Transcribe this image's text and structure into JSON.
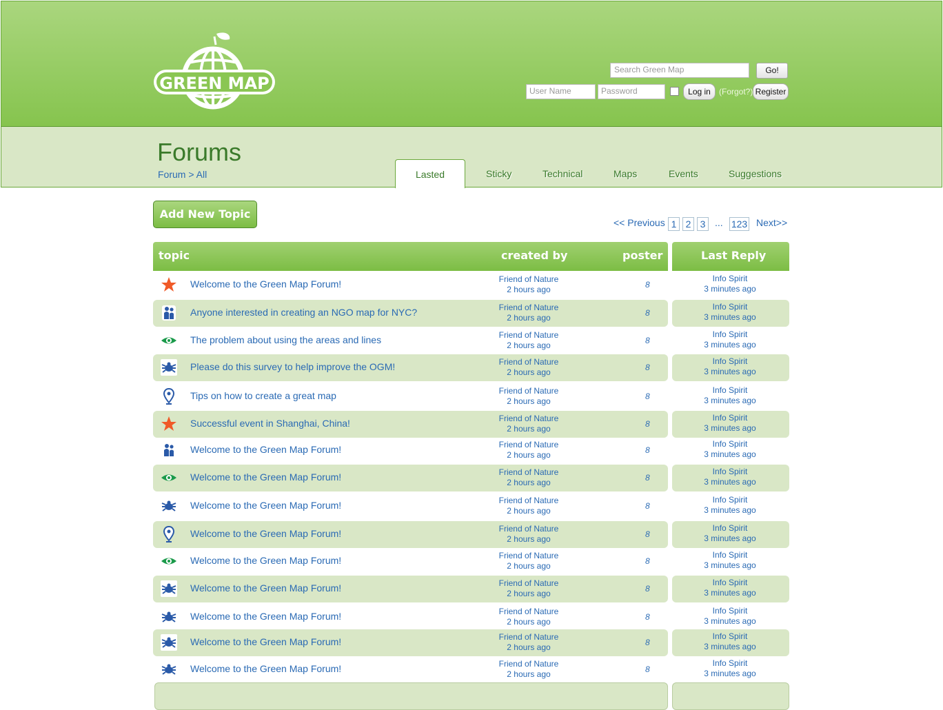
{
  "header": {
    "logo_text": "GREEN MAP",
    "search": {
      "placeholder": "Search Green Map",
      "button": "Go!"
    },
    "login": {
      "username_placeholder": "User Name",
      "password_placeholder": "Password",
      "login_button": "Log in",
      "forgot": "(Forgot?)",
      "register_button": "Register"
    }
  },
  "page": {
    "title": "Forums",
    "breadcrumb": "Forum > All"
  },
  "tabs": [
    {
      "label": "Lasted",
      "active": true
    },
    {
      "label": "Sticky"
    },
    {
      "label": "Technical"
    },
    {
      "label": "Maps"
    },
    {
      "label": "Events"
    },
    {
      "label": "Suggestions"
    }
  ],
  "actions": {
    "add_topic": "Add New Topic"
  },
  "pager": {
    "previous": "<< Previous",
    "pages": [
      "1",
      "2",
      "3"
    ],
    "ellipsis": "...",
    "last_page": "123",
    "next": "Next>>"
  },
  "table": {
    "headers": {
      "topic": "topic",
      "created_by": "created by",
      "poster": "poster",
      "last_reply": "Last Reply"
    },
    "rows": [
      {
        "icon": "star-icon",
        "title": "Welcome to the Green Map Forum!",
        "creator": "Friend of Nature",
        "created": "2 hours ago",
        "poster": "8",
        "last_user": "Info Spirit",
        "last_time": "3 minutes ago"
      },
      {
        "icon": "people-icon",
        "title": "Anyone interested in creating an NGO map for NYC?",
        "creator": "Friend of Nature",
        "created": "2 hours ago",
        "poster": "8",
        "last_user": "Info Spirit",
        "last_time": "3 minutes ago"
      },
      {
        "icon": "eye-icon",
        "title": "The problem about using the areas and lines",
        "creator": "Friend of Nature",
        "created": "2 hours ago",
        "poster": "8",
        "last_user": "Info Spirit",
        "last_time": "3 minutes ago"
      },
      {
        "icon": "bug-icon",
        "title": "Please do this survey to help improve the OGM!",
        "creator": "Friend of Nature",
        "created": "2 hours ago",
        "poster": "8",
        "last_user": "Info Spirit",
        "last_time": "3 minutes ago"
      },
      {
        "icon": "pin-icon",
        "title": "Tips on how to create a great map",
        "creator": "Friend of Nature",
        "created": "2 hours ago",
        "poster": "8",
        "last_user": "Info Spirit",
        "last_time": "3 minutes ago"
      },
      {
        "icon": "star-icon",
        "title": "Successful event in Shanghai, China!",
        "creator": "Friend of Nature",
        "created": "2 hours ago",
        "poster": "8",
        "last_user": "Info Spirit",
        "last_time": "3 minutes ago"
      },
      {
        "icon": "people-icon",
        "title": "Welcome to the Green Map Forum!",
        "creator": "Friend of Nature",
        "created": "2 hours ago",
        "poster": "8",
        "last_user": "Info Spirit",
        "last_time": "3 minutes ago"
      },
      {
        "icon": "eye-icon",
        "title": "Welcome to the Green Map Forum!",
        "creator": "Friend of Nature",
        "created": "2 hours ago",
        "poster": "8",
        "last_user": "Info Spirit",
        "last_time": "3 minutes ago"
      },
      {
        "icon": "bug-icon",
        "title": "Welcome to the Green Map Forum!",
        "creator": "Friend of Nature",
        "created": "2 hours ago",
        "poster": "8",
        "last_user": "Info Spirit",
        "last_time": "3 minutes ago"
      },
      {
        "icon": "pin-icon",
        "title": "Welcome to the Green Map Forum!",
        "creator": "Friend of Nature",
        "created": "2 hours ago",
        "poster": "8",
        "last_user": "Info Spirit",
        "last_time": "3 minutes ago"
      },
      {
        "icon": "eye-icon",
        "title": "Welcome to the Green Map Forum!",
        "creator": "Friend of Nature",
        "created": "2 hours ago",
        "poster": "8",
        "last_user": "Info Spirit",
        "last_time": "3 minutes ago"
      },
      {
        "icon": "bug-icon",
        "title": "Welcome to the Green Map Forum!",
        "creator": "Friend of Nature",
        "created": "2 hours ago",
        "poster": "8",
        "last_user": "Info Spirit",
        "last_time": "3 minutes ago"
      },
      {
        "icon": "bug-icon",
        "title": "Welcome to the Green Map Forum!",
        "creator": "Friend of Nature",
        "created": "2 hours ago",
        "poster": "8",
        "last_user": "Info Spirit",
        "last_time": "3 minutes ago"
      },
      {
        "icon": "bug-icon",
        "title": "Welcome to the Green Map Forum!",
        "creator": "Friend of Nature",
        "created": "2 hours ago",
        "poster": "8",
        "last_user": "Info Spirit",
        "last_time": "3 minutes ago"
      },
      {
        "icon": "bug-icon",
        "title": "Welcome to the Green Map Forum!",
        "creator": "Friend of Nature",
        "created": "2 hours ago",
        "poster": "8",
        "last_user": "Info Spirit",
        "last_time": "3 minutes ago"
      }
    ]
  },
  "colors": {
    "header_green": "#86c44e",
    "pale_green": "#d9e7c6",
    "title_green": "#3a7a2a",
    "link_blue": "#2a6ab4",
    "star_orange": "#f05a28",
    "eye_green": "#1a9a4a",
    "icon_blue": "#2a5aa8"
  }
}
